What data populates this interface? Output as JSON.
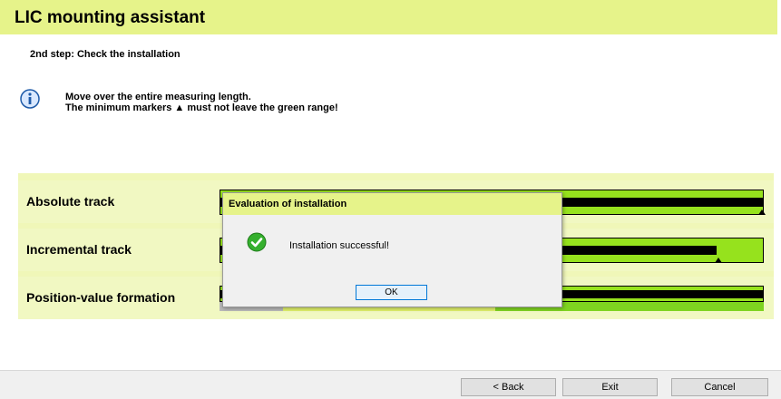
{
  "app": {
    "title": "LIC mounting assistant"
  },
  "step": {
    "label": "2nd step: Check the installation"
  },
  "info": {
    "icon": "info-icon",
    "line1": "Move over the entire measuring length.",
    "line2": "The minimum markers ▲ must not leave the green range!"
  },
  "tracks": [
    {
      "label": "Absolute track",
      "level": 1.0,
      "marker": 1.0
    },
    {
      "label": "Incremental track",
      "level": 0.915,
      "marker": 0.92
    },
    {
      "label": "Position-value formation",
      "level": 1.0,
      "marker": 1.0
    }
  ],
  "colors": {
    "accent": "#e6f38a",
    "panel": "#f1f8c2",
    "green": "#96e21d",
    "range_grey": "#b9b9b9",
    "range_yellow": "#dff06a",
    "range_green": "#7ed320"
  },
  "footer": {
    "back": "< Back",
    "exit": "Exit",
    "cancel": "Cancel"
  },
  "dialog": {
    "title": "Evaluation of installation",
    "icon": "success-check-icon",
    "message": "Installation successful!",
    "ok": "OK"
  }
}
